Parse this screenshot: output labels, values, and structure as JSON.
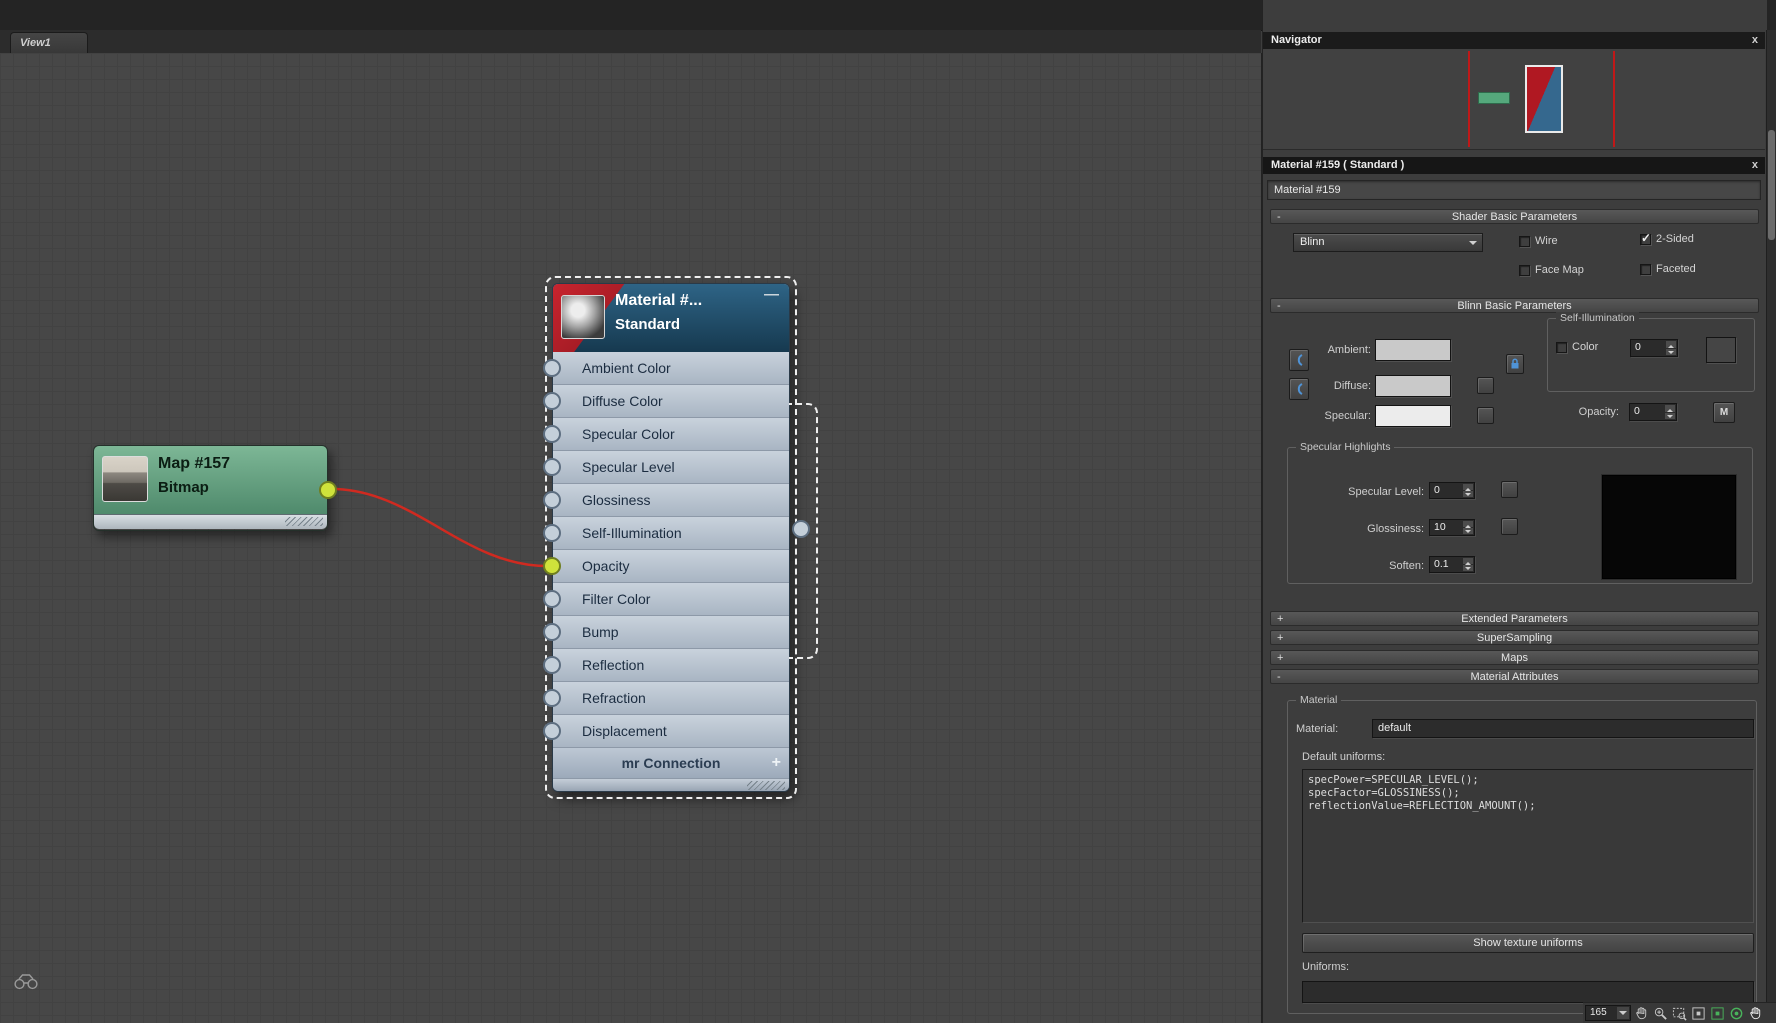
{
  "glyphs": {
    "close": "x",
    "minus": "—",
    "plus": "+"
  },
  "top_bar": {
    "view_selector": "View1"
  },
  "canvas": {
    "tab": "View1",
    "map_node": {
      "title": "Map #157",
      "subtitle": "Bitmap"
    },
    "material_node": {
      "title": "Material #...",
      "subtitle": "Standard",
      "slots": [
        "Ambient Color",
        "Diffuse Color",
        "Specular Color",
        "Specular Level",
        "Glossiness",
        "Self-Illumination",
        "Opacity",
        "Filter Color",
        "Bump",
        "Reflection",
        "Refraction",
        "Displacement"
      ],
      "footer_slot": "mr Connection"
    },
    "wire_color": "#d02a20"
  },
  "navigator": {
    "title": "Navigator"
  },
  "editor": {
    "title": "Material #159  ( Standard )",
    "name": "Material #159",
    "shader_basic": {
      "state": "-",
      "title": "Shader Basic Parameters",
      "shader": "Blinn",
      "wire": {
        "label": "Wire",
        "mark": ""
      },
      "two_sided": {
        "label": "2-Sided",
        "mark": "✓"
      },
      "face_map": {
        "label": "Face Map",
        "mark": ""
      },
      "faceted": {
        "label": "Faceted",
        "mark": ""
      }
    },
    "blinn_basic": {
      "state": "-",
      "title": "Blinn Basic Parameters",
      "ambient_label": "Ambient:",
      "diffuse_label": "Diffuse:",
      "specular_label": "Specular:",
      "self_illum": {
        "group": "Self-Illumination",
        "color_label": "Color",
        "color_mark": "",
        "value": "0"
      },
      "opacity_label": "Opacity:",
      "opacity_value": "0",
      "map_button": "M",
      "highlights": {
        "group": "Specular Highlights",
        "spec_level_label": "Specular Level:",
        "spec_level": "0",
        "glossiness_label": "Glossiness:",
        "glossiness": "10",
        "soften_label": "Soften:",
        "soften": "0.1"
      }
    },
    "extended": {
      "state": "+",
      "title": "Extended Parameters"
    },
    "supersampling": {
      "state": "+",
      "title": "SuperSampling"
    },
    "maps": {
      "state": "+",
      "title": "Maps"
    },
    "attributes": {
      "state": "-",
      "title": "Material Attributes",
      "group": "Material",
      "material_label": "Material:",
      "material_value": "default",
      "default_uniforms_label": "Default uniforms:",
      "code": [
        "specPower=SPECULAR_LEVEL();",
        "specFactor=GLOSSINESS();",
        "reflectionValue=REFLECTION_AMOUNT();"
      ],
      "show_button": "Show texture uniforms",
      "uniforms_label": "Uniforms:"
    }
  },
  "status": {
    "zoom": "165"
  }
}
